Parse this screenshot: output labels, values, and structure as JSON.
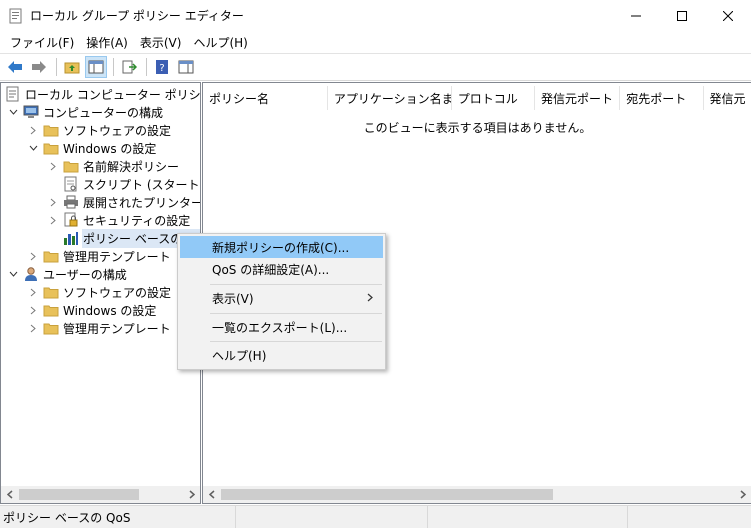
{
  "window": {
    "title": "ローカル グループ ポリシー エディター"
  },
  "menubar": {
    "items": [
      "ファイル(F)",
      "操作(A)",
      "表示(V)",
      "ヘルプ(H)"
    ]
  },
  "tree": {
    "root": "ローカル コンピューター ポリシー",
    "computer_config": "コンピューターの構成",
    "software_settings": "ソフトウェアの設定",
    "windows_settings": "Windows の設定",
    "name_resolution": "名前解決ポリシー",
    "scripts": "スクリプト (スタートアップ/",
    "printers": "展開されたプリンター",
    "security": "セキュリティの設定",
    "qos": "ポリシー ベースの Qo",
    "admin_templates": "管理用テンプレート",
    "user_config": "ユーザーの構成",
    "user_software": "ソフトウェアの設定",
    "user_windows": "Windows の設定",
    "user_admin": "管理用テンプレート"
  },
  "list": {
    "columns": [
      "ポリシー名",
      "アプリケーション名また...",
      "プロトコル",
      "発信元ポート",
      "宛先ポート",
      "発信元"
    ],
    "empty_message": "このビューに表示する項目はありません。"
  },
  "context_menu": {
    "new_policy": "新規ポリシーの作成(C)...",
    "qos_advanced": "QoS の詳細設定(A)...",
    "view": "表示(V)",
    "export": "一覧のエクスポート(L)...",
    "help": "ヘルプ(H)"
  },
  "status": {
    "text": "ポリシー ベースの QoS"
  },
  "colors": {
    "highlight": "#91c9f7",
    "folder": "#e8c15a",
    "nav_arrow": "#2f79c9"
  }
}
